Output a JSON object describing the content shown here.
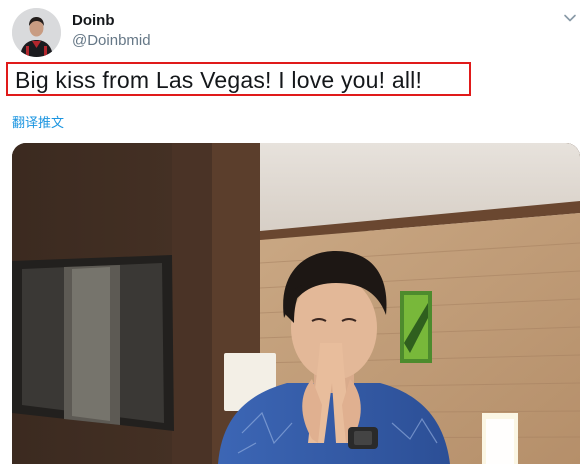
{
  "tweet": {
    "display_name": "Doinb",
    "handle": "@Doinbmid",
    "text": "Big kiss from Las Vegas!  I love you!  all!",
    "translate_label": "翻译推文"
  },
  "icons": {
    "avatar": "user-avatar",
    "menu": "chevron-down-icon"
  },
  "colors": {
    "accent": "#1b95e0",
    "highlight_border": "#e01a1a",
    "name": "#14171a",
    "handle": "#657786"
  }
}
